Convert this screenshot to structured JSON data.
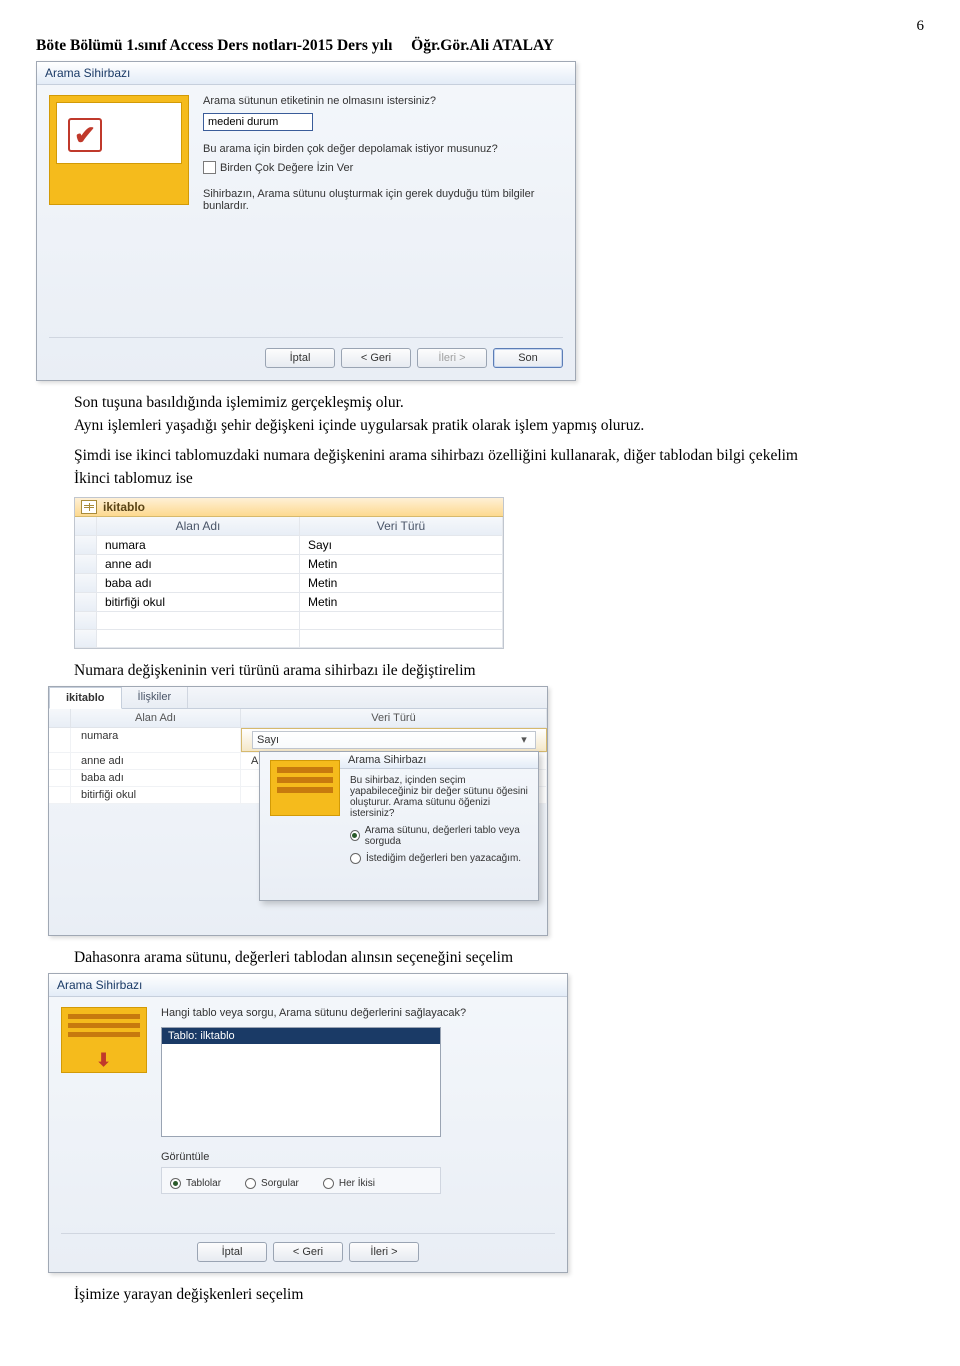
{
  "page_number": "6",
  "header": {
    "left": "Böte Bölümü 1.sınıf Access Ders notları-2015 Ders yılı",
    "right": "Öğr.Gör.Ali ATALAY"
  },
  "wizard1": {
    "title": "Arama Sihirbazı",
    "q1": "Arama sütunun etiketinin ne olmasını istersiniz?",
    "input_value": "medeni durum",
    "q2": "Bu arama için birden çok değer depolamak istiyor musunuz?",
    "chk_label": "Birden Çok Değere İzin Ver",
    "info": "Sihirbazın, Arama sütunu oluşturmak için gerek duyduğu tüm bilgiler bunlardır.",
    "buttons": {
      "cancel": "İptal",
      "back": "< Geri",
      "next": "İleri >",
      "finish": "Son"
    }
  },
  "para1": "Son tuşuna basıldığında işlemimiz gerçekleşmiş olur.",
  "para2": "Aynı işlemleri yaşadığı şehir değişkeni içinde uygularsak pratik olarak işlem yapmış oluruz.",
  "para3": "Şimdi ise ikinci tablomuzdaki numara değişkenini arama sihirbazı özelliğini kullanarak, diğer tablodan bilgi çekelim",
  "para4": "İkinci tablomuz ise",
  "table": {
    "tab": "ikitablo",
    "col1": "Alan Adı",
    "col2": "Veri Türü",
    "rows": [
      {
        "name": "numara",
        "type": "Sayı"
      },
      {
        "name": "anne adı",
        "type": "Metin"
      },
      {
        "name": "baba adı",
        "type": "Metin"
      },
      {
        "name": "bitirfiği okul",
        "type": "Metin"
      }
    ]
  },
  "para5": "Numara değişkeninin veri türünü arama sihirbazı ile değiştirelim",
  "panel2": {
    "tab1": "ikitablo",
    "tab2": "İlişkiler",
    "col1": "Alan Adı",
    "col2": "Veri Türü",
    "rows": {
      "numara": "numara",
      "numara_type": "Sayı",
      "anne": "anne adı",
      "anne_type": "Arama Sihirbazı",
      "baba": "baba adı",
      "okul": "bitirfiği okul"
    },
    "popup": {
      "title": "Arama Sihirbazı",
      "text": "Bu sihirbaz, içinden seçim yapabileceğiniz bir değer sütunu öğesini oluşturur. Arama sütunu öğenizi istersiniz?",
      "opt1": "Arama sütunu, değerleri tablo veya sorguda",
      "opt2": "İstediğim değerleri ben yazacağım."
    }
  },
  "para6": "Dahasonra  arama sütunu, değerleri tablodan alınsın seçeneğini seçelim",
  "wizard3": {
    "title": "Arama Sihirbazı",
    "q": "Hangi tablo veya sorgu, Arama sütunu değerlerini sağlayacak?",
    "item": "Tablo: ilktablo",
    "view_label": "Görüntüle",
    "opt_tables": "Tablolar",
    "opt_queries": "Sorgular",
    "opt_both": "Her İkisi",
    "buttons": {
      "cancel": "İptal",
      "back": "< Geri",
      "next": "İleri >"
    }
  },
  "para7": "İşimize yarayan değişkenleri seçelim"
}
